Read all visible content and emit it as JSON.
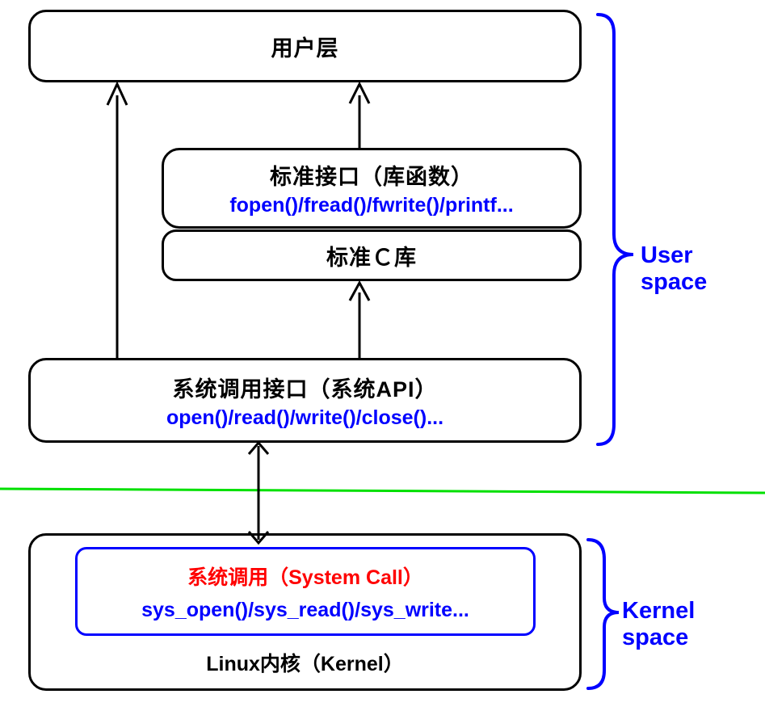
{
  "layers": {
    "user_layer": {
      "title": "用户层"
    },
    "std_interface": {
      "title": "标准接口（库函数）",
      "apis": "fopen()/fread()/fwrite()/printf..."
    },
    "std_c_lib": {
      "title": "标准Ｃ库"
    },
    "syscall_interface": {
      "title": "系统调用接口（系统API）",
      "apis": "open()/read()/write()/close()..."
    },
    "kernel_box": {
      "syscall_title": "系统调用（System Call）",
      "syscall_apis": "sys_open()/sys_read()/sys_write...",
      "kernel_label": "Linux内核（Kernel）"
    }
  },
  "space_labels": {
    "user": "User space",
    "kernel": "Kernel space"
  },
  "colors": {
    "blue": "#0000ff",
    "red": "#ff0000",
    "green": "#00e000",
    "black": "#000000"
  }
}
